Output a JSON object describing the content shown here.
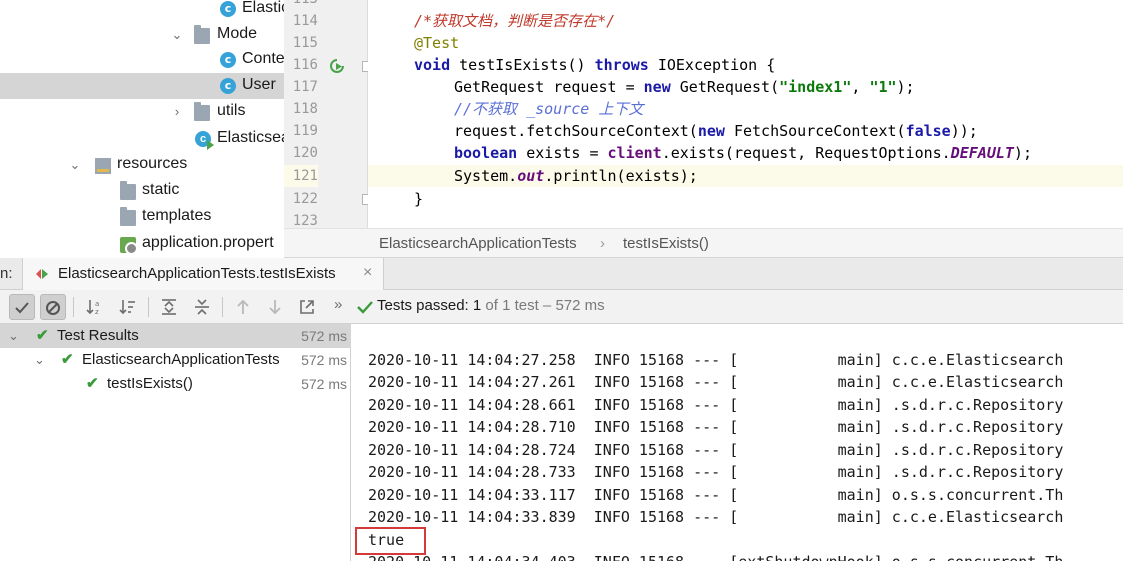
{
  "project_tree": {
    "items": [
      {
        "label": "Elastic",
        "kind": "class"
      },
      {
        "label": "Mode",
        "kind": "folder"
      },
      {
        "label": "Conte",
        "kind": "class"
      },
      {
        "label": "User",
        "kind": "class"
      },
      {
        "label": "utils",
        "kind": "folder"
      },
      {
        "label": "Elasticsea",
        "kind": "class"
      },
      {
        "label": "resources",
        "kind": "resources"
      },
      {
        "label": "static",
        "kind": "folder"
      },
      {
        "label": "templates",
        "kind": "folder"
      },
      {
        "label": "application.propert",
        "kind": "properties"
      }
    ]
  },
  "editor": {
    "lines": [
      {
        "no": "114"
      },
      {
        "no": "115"
      },
      {
        "no": "116"
      },
      {
        "no": "117"
      },
      {
        "no": "118"
      },
      {
        "no": "119"
      },
      {
        "no": "120"
      },
      {
        "no": "121"
      },
      {
        "no": "122"
      },
      {
        "no": "123"
      }
    ],
    "code": {
      "l114_comment": "/*获取文档，判断是否存在*/",
      "l115_annotation": "@Test",
      "l116_void": "void",
      "l116_name": " testIsExists() ",
      "l116_throws": "throws",
      "l116_rest": " IOException {",
      "l117_a": "GetRequest request = ",
      "l117_new": "new",
      "l117_b": " GetRequest(",
      "l117_s1": "\"index1\"",
      "l117_c": ", ",
      "l117_s2": "\"1\"",
      "l117_d": ");",
      "l118_comment": "//不获取 _source 上下文",
      "l119_a": "request.fetchSourceContext(",
      "l119_new": "new",
      "l119_b": " FetchSourceContext(",
      "l119_false": "false",
      "l119_c": "));",
      "l120_bool": "boolean",
      "l120_a": " exists = ",
      "l120_client": "client",
      "l120_b": ".exists(request, RequestOptions.",
      "l120_default": "DEFAULT",
      "l120_c": ");",
      "l121_a": "System.",
      "l121_out": "out",
      "l121_b": ".println(exists);",
      "l122": "}"
    },
    "breadcrumb": [
      "ElasticsearchApplicationTests",
      "testIsExists()"
    ]
  },
  "run": {
    "tab_prefix": "n:",
    "tab_label": "ElasticsearchApplicationTests.testIsExists",
    "close": "×",
    "status_prefix": "Tests passed: ",
    "status_passed": "1",
    "status_suffix": " of 1 test – 572 ms",
    "more": "»",
    "results": [
      {
        "label": "Test Results",
        "duration": "572 ms"
      },
      {
        "label": "ElasticsearchApplicationTests",
        "duration": "572 ms"
      },
      {
        "label": "testIsExists()",
        "duration": "572 ms"
      }
    ],
    "console_lines": [
      "2020-10-11 14:04:27.258  INFO 15168 --- [           main] c.c.e.Elasticsearch",
      "2020-10-11 14:04:27.261  INFO 15168 --- [           main] c.c.e.Elasticsearch",
      "2020-10-11 14:04:28.661  INFO 15168 --- [           main] .s.d.r.c.Repository",
      "2020-10-11 14:04:28.710  INFO 15168 --- [           main] .s.d.r.c.Repository",
      "2020-10-11 14:04:28.724  INFO 15168 --- [           main] .s.d.r.c.Repository",
      "2020-10-11 14:04:28.733  INFO 15168 --- [           main] .s.d.r.c.Repository",
      "2020-10-11 14:04:33.117  INFO 15168 --- [           main] o.s.s.concurrent.Th",
      "2020-10-11 14:04:33.839  INFO 15168 --- [           main] c.c.e.Elasticsearch",
      "true",
      "2020-10-11 14:04:34.403  INFO 15168 --- [extShutdownHook] o.s.s.concurrent.Th"
    ]
  },
  "colors": {
    "pass_green": "#3a9b3a",
    "highlight_box": "#d43a3a",
    "keyword": "#1a1aa6",
    "string": "#0b7a0b"
  }
}
